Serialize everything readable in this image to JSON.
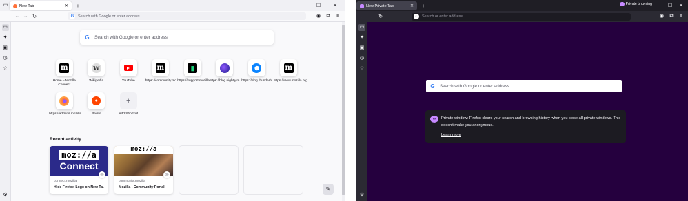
{
  "normal_window": {
    "tab_title": "New Tab",
    "url_placeholder": "Search with Google or enter address",
    "search_placeholder": "Search with Google or enter address",
    "shortcuts": [
      {
        "label": "Home – Mozilla Connect",
        "icon": "mozilla-m-icon"
      },
      {
        "label": "Wikipedia",
        "icon": "wikipedia-icon"
      },
      {
        "label": "YouTube",
        "icon": "youtube-icon"
      },
      {
        "label": "https://community.mo...",
        "icon": "mozilla-m-icon"
      },
      {
        "label": "https://support.mozilla...",
        "icon": "mozilla-support-icon"
      },
      {
        "label": "https://blog.nightly.m...",
        "icon": "firefox-nightly-icon"
      },
      {
        "label": "https://blog.thunderbi...",
        "icon": "thunderbird-icon"
      },
      {
        "label": "https://www.mozilla.org",
        "icon": "mozilla-m-icon"
      },
      {
        "label": "https://addons.mozilla...",
        "icon": "firefox-icon"
      },
      {
        "label": "Reddit",
        "icon": "reddit-icon"
      },
      {
        "label": "Add Shortcut",
        "icon": "plus-icon"
      }
    ],
    "recent_activity": {
      "title": "Recent activity",
      "cards": [
        {
          "site": "connect.mozilla",
          "title": "Hide Firefox Logo on New Ta...",
          "thumb_text_1": "moz://a",
          "thumb_text_2": "Connect"
        },
        {
          "site": "community.mozilla",
          "title": "Mozilla - Community Portal",
          "thumb_text_1": "moz://a"
        }
      ]
    }
  },
  "private_window": {
    "tab_title": "New Private Tab",
    "badge": "Private browsing",
    "url_placeholder": "Search or enter address",
    "search_placeholder": "Search with Google or enter address",
    "info_text": "Private window: Firefox clears your search and browsing history when you close all private windows. This doesn't make you anonymous.",
    "learn_more": "Learn more"
  },
  "colors": {
    "private_bg": "#25003e",
    "private_accent": "#c689ff",
    "light_bg": "#f9f9fb"
  }
}
